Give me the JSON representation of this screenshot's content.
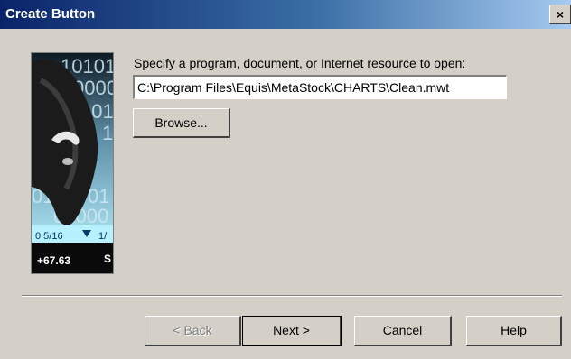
{
  "window": {
    "title": "Create Button",
    "close_label": "×"
  },
  "wizard_image": {
    "digits": [
      "10101",
      "0000",
      "101",
      "1",
      "01",
      "0101",
      "01000"
    ],
    "ticker_fraction": "0 5/16",
    "ticker_fraction_right": "1/",
    "ticker_change": "+67.63",
    "ticker_letter": "S"
  },
  "prompt": "Specify a program, document, or Internet resource to open:",
  "path_input": {
    "value": "C:\\Program Files\\Equis\\MetaStock\\CHARTS\\Clean.mwt"
  },
  "buttons": {
    "browse": "Browse...",
    "back": "< Back",
    "next": "Next >",
    "cancel": "Cancel",
    "help": "Help"
  }
}
